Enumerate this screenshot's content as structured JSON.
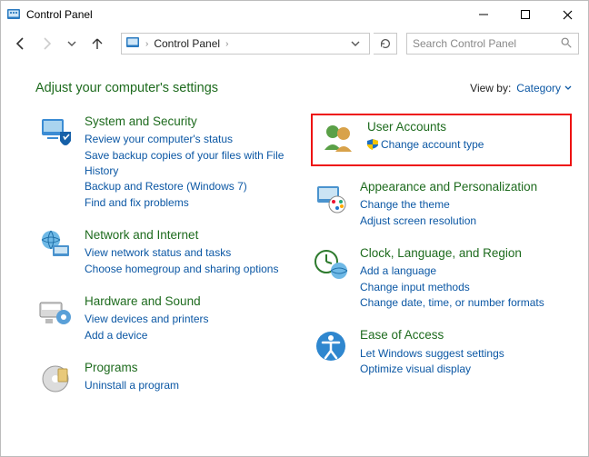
{
  "window": {
    "title": "Control Panel"
  },
  "address": {
    "crumb1": "Control Panel",
    "crumbRightChevron": "›"
  },
  "search": {
    "placeholder": "Search Control Panel"
  },
  "header": {
    "headline": "Adjust your computer's settings",
    "viewByLabel": "View by:",
    "viewByValue": "Category"
  },
  "left": {
    "cat1": {
      "title": "System and Security",
      "link1": "Review your computer's status",
      "link2": "Save backup copies of your files with File History",
      "link3": "Backup and Restore (Windows 7)",
      "link4": "Find and fix problems"
    },
    "cat2": {
      "title": "Network and Internet",
      "link1": "View network status and tasks",
      "link2": "Choose homegroup and sharing options"
    },
    "cat3": {
      "title": "Hardware and Sound",
      "link1": "View devices and printers",
      "link2": "Add a device"
    },
    "cat4": {
      "title": "Programs",
      "link1": "Uninstall a program"
    }
  },
  "right": {
    "cat1": {
      "title": "User Accounts",
      "link1": "Change account type"
    },
    "cat2": {
      "title": "Appearance and Personalization",
      "link1": "Change the theme",
      "link2": "Adjust screen resolution"
    },
    "cat3": {
      "title": "Clock, Language, and Region",
      "link1": "Add a language",
      "link2": "Change input methods",
      "link3": "Change date, time, or number formats"
    },
    "cat4": {
      "title": "Ease of Access",
      "link1": "Let Windows suggest settings",
      "link2": "Optimize visual display"
    }
  }
}
